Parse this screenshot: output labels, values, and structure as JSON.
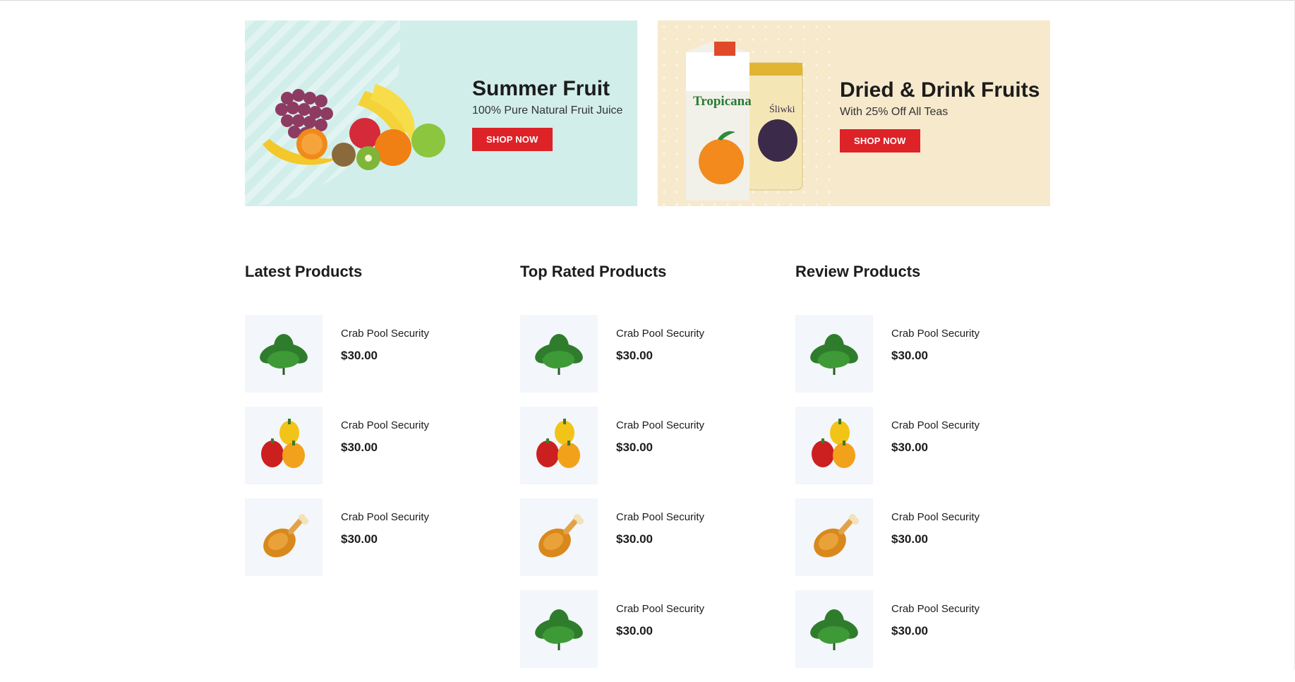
{
  "banners": [
    {
      "title": "Summer Fruit",
      "subtitle": "100% Pure Natural Fruit Juice",
      "button": "SHOP NOW"
    },
    {
      "title": "Dried & Drink Fruits",
      "subtitle": "With 25% Off All Teas",
      "button": "SHOP NOW"
    }
  ],
  "packaging": {
    "brand1": "Tropicana",
    "brand2": "Śliwki"
  },
  "sections": [
    {
      "title": "Latest Products",
      "items": [
        {
          "name": "Crab Pool Security",
          "price": "$30.00",
          "icon": "spinach-icon"
        },
        {
          "name": "Crab Pool Security",
          "price": "$30.00",
          "icon": "peppers-icon"
        },
        {
          "name": "Crab Pool Security",
          "price": "$30.00",
          "icon": "chicken-leg-icon"
        }
      ]
    },
    {
      "title": "Top Rated Products",
      "items": [
        {
          "name": "Crab Pool Security",
          "price": "$30.00",
          "icon": "spinach-icon"
        },
        {
          "name": "Crab Pool Security",
          "price": "$30.00",
          "icon": "peppers-icon"
        },
        {
          "name": "Crab Pool Security",
          "price": "$30.00",
          "icon": "chicken-leg-icon"
        },
        {
          "name": "Crab Pool Security",
          "price": "$30.00",
          "icon": "spinach-icon"
        }
      ]
    },
    {
      "title": "Review Products",
      "items": [
        {
          "name": "Crab Pool Security",
          "price": "$30.00",
          "icon": "spinach-icon"
        },
        {
          "name": "Crab Pool Security",
          "price": "$30.00",
          "icon": "peppers-icon"
        },
        {
          "name": "Crab Pool Security",
          "price": "$30.00",
          "icon": "chicken-leg-icon"
        },
        {
          "name": "Crab Pool Security",
          "price": "$30.00",
          "icon": "spinach-icon"
        }
      ]
    }
  ],
  "colors": {
    "accent": "#dd2228",
    "banner1_bg": "#d1eeea",
    "banner2_bg": "#f7e9cc",
    "thumb_bg": "#f3f6fa"
  }
}
